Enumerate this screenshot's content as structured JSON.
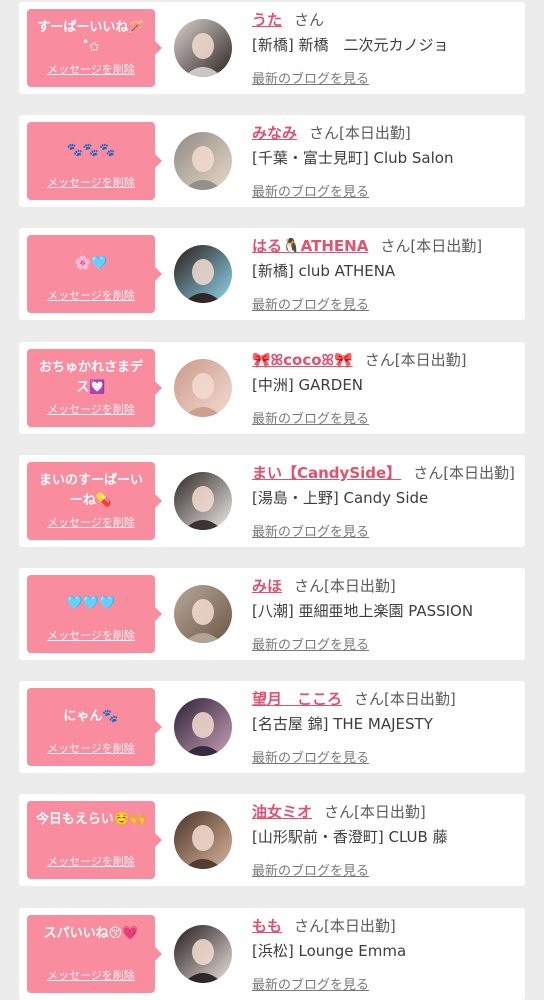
{
  "messages": [
    {
      "message": "すーぱーいいね🪄 ˚✩",
      "delete_label": "メッセージを削除",
      "name": "うた",
      "honorific": "さん",
      "badge": "",
      "shop": "[新橋] 新橋　二次元カノジョ",
      "blog_link": "最新のブログを見る",
      "avatar_colors": [
        "#d9d2cf",
        "#2c2422"
      ]
    },
    {
      "message": "🐾🐾🐾",
      "delete_label": "メッセージを削除",
      "name": "みなみ",
      "honorific": "さん",
      "badge": "[本日出勤]",
      "shop": "[千葉・富士見町] Club Salon",
      "blog_link": "最新のブログを見る",
      "avatar_colors": [
        "#8f8a86",
        "#e9d9c6"
      ]
    },
    {
      "message": "🌸🩵",
      "delete_label": "メッセージを削除",
      "name": "はる🐧ATHENA",
      "honorific": "さん",
      "badge": "[本日出勤]",
      "shop": "[新橋] club ATHENA",
      "blog_link": "最新のブログを見る",
      "avatar_colors": [
        "#2a1a18",
        "#8fd9ef"
      ]
    },
    {
      "message": "おちゅかれさまデス💟",
      "delete_label": "メッセージを削除",
      "name": "🎀ꕤcocoꕤ🎀",
      "honorific": "さん",
      "badge": "[本日出勤]",
      "shop": "[中洲] GARDEN",
      "blog_link": "最新のブログを見る",
      "avatar_colors": [
        "#c99a8a",
        "#f4dcd2"
      ]
    },
    {
      "message": "まいのすーぱーいーね💊",
      "delete_label": "メッセージを削除",
      "name": "まい【CandySide】",
      "honorific": "さん",
      "badge": "[本日出勤]",
      "shop": "[湯島・上野] Candy Side",
      "blog_link": "最新のブログを見る",
      "avatar_colors": [
        "#2d2623",
        "#f1ece9"
      ]
    },
    {
      "message": "🩵🩵🩵",
      "delete_label": "メッセージを削除",
      "name": "みほ",
      "honorific": "さん",
      "badge": "[本日出勤]",
      "shop": "[八潮] 亜細亜地上楽園 PASSION",
      "blog_link": "最新のブログを見る",
      "avatar_colors": [
        "#b7a99b",
        "#6d5644"
      ]
    },
    {
      "message": "にゃん🐾",
      "delete_label": "メッセージを削除",
      "name": "望月　こころ",
      "honorific": "さん",
      "badge": "[本日出勤]",
      "shop": "[名古屋 錦] THE MAJESTY",
      "blog_link": "最新のブログを見る",
      "avatar_colors": [
        "#2b2136",
        "#caa0b8"
      ]
    },
    {
      "message": "今日もえらい☺️🙌",
      "delete_label": "メッセージを削除",
      "name": "油女ミオ",
      "honorific": "さん",
      "badge": "[本日出勤]",
      "shop": "[山形駅前・香澄町] CLUB 藤",
      "blog_link": "最新のブログを見る",
      "avatar_colors": [
        "#4a3428",
        "#d9b59a"
      ]
    },
    {
      "message": "スパいいね😚💗",
      "delete_label": "メッセージを削除",
      "name": "もも",
      "honorific": "さん",
      "badge": "[本日出勤]",
      "shop": "[浜松] Lounge Emma",
      "blog_link": "最新のブログを見る",
      "avatar_colors": [
        "#1f1a1a",
        "#efe3de"
      ]
    }
  ]
}
